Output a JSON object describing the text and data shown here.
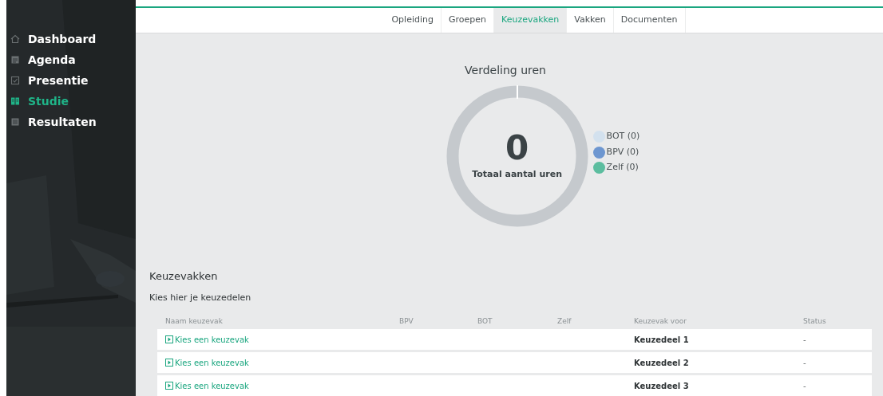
{
  "sidebar": {
    "items": [
      {
        "label": "Dashboard",
        "selected": false
      },
      {
        "label": "Agenda",
        "selected": false
      },
      {
        "label": "Presentie",
        "selected": false
      },
      {
        "label": "Studie",
        "selected": true
      },
      {
        "label": "Resultaten",
        "selected": false
      }
    ]
  },
  "tabs": [
    {
      "label": "Opleiding",
      "selected": false
    },
    {
      "label": "Groepen",
      "selected": false
    },
    {
      "label": "Keuzevakken",
      "selected": true
    },
    {
      "label": "Vakken",
      "selected": false
    },
    {
      "label": "Documenten",
      "selected": false
    }
  ],
  "summary": {
    "title": "Verdeling uren",
    "total": "0",
    "total_label": "Totaal aantal uren",
    "legend": [
      {
        "label": "BOT (0)",
        "color": "#d3e1ee"
      },
      {
        "label": "BPV (0)",
        "color": "#6d96d0"
      },
      {
        "label": "Zelf (0)",
        "color": "#5cbd9f"
      }
    ]
  },
  "section": {
    "title": "Keuzevakken",
    "subtitle": "Kies hier je keuzedelen"
  },
  "table": {
    "columns": [
      "Naam keuzevak",
      "BPV",
      "BOT",
      "Zelf",
      "Keuzevak voor",
      "Status"
    ],
    "rows": [
      {
        "name": "Kies een keuzevak",
        "for": "Keuzedeel 1",
        "status": "-"
      },
      {
        "name": "Kies een keuzevak",
        "for": "Keuzedeel 2",
        "status": "-"
      },
      {
        "name": "Kies een keuzevak",
        "for": "Keuzedeel 3",
        "status": "-"
      }
    ]
  }
}
